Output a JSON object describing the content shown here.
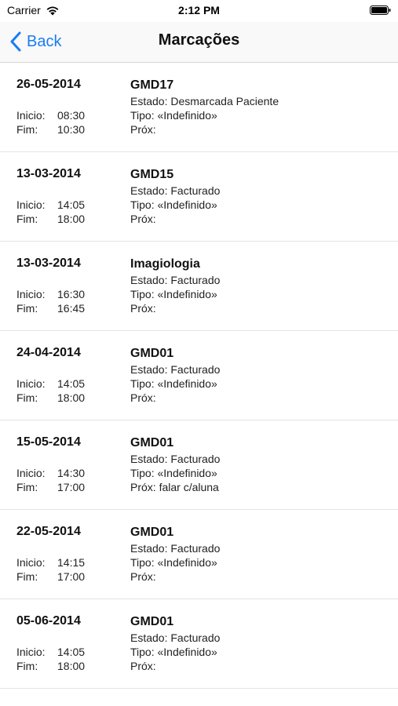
{
  "status_bar": {
    "carrier": "Carrier",
    "time": "2:12 PM"
  },
  "nav": {
    "back_label": "Back",
    "title": "Marcações",
    "accent_color": "#1a7cf5"
  },
  "labels": {
    "inicio": "Inicio:",
    "fim": "Fim:",
    "estado_prefix": "Estado:",
    "tipo_prefix": "Tipo:",
    "prox_prefix": "Próx:"
  },
  "appointments": [
    {
      "date": "26-05-2014",
      "start": "08:30",
      "end": "10:30",
      "title": "GMD17",
      "estado": "Desmarcada Paciente",
      "tipo": "«Indefinido»",
      "prox": ""
    },
    {
      "date": "13-03-2014",
      "start": "14:05",
      "end": "18:00",
      "title": "GMD15",
      "estado": "Facturado",
      "tipo": "«Indefinido»",
      "prox": ""
    },
    {
      "date": "13-03-2014",
      "start": "16:30",
      "end": "16:45",
      "title": "Imagiologia",
      "estado": "Facturado",
      "tipo": "«Indefinido»",
      "prox": ""
    },
    {
      "date": "24-04-2014",
      "start": "14:05",
      "end": "18:00",
      "title": "GMD01",
      "estado": "Facturado",
      "tipo": "«Indefinido»",
      "prox": ""
    },
    {
      "date": "15-05-2014",
      "start": "14:30",
      "end": "17:00",
      "title": "GMD01",
      "estado": "Facturado",
      "tipo": "«Indefinido»",
      "prox": "falar c/aluna"
    },
    {
      "date": "22-05-2014",
      "start": "14:15",
      "end": "17:00",
      "title": "GMD01",
      "estado": "Facturado",
      "tipo": "«Indefinido»",
      "prox": ""
    },
    {
      "date": "05-06-2014",
      "start": "14:05",
      "end": "18:00",
      "title": "GMD01",
      "estado": "Facturado",
      "tipo": "«Indefinido»",
      "prox": ""
    }
  ]
}
